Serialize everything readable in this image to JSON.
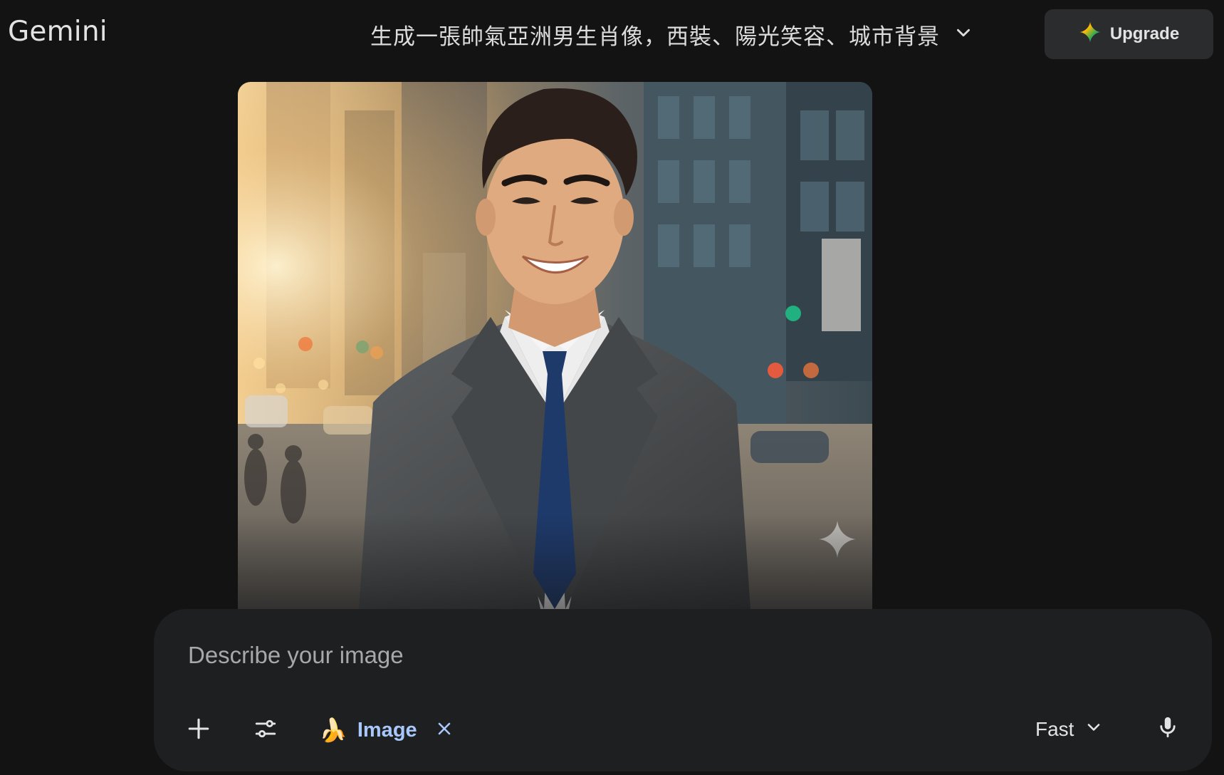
{
  "app": {
    "brand": "Gemini"
  },
  "header": {
    "conversation_title": "生成一張帥氣亞洲男生肖像，西裝、陽光笑容、城市背景",
    "upgrade_label": "Upgrade"
  },
  "composer": {
    "placeholder": "Describe your image",
    "value": "",
    "tool_chip": {
      "label": "Image",
      "emoji": "🍌"
    },
    "model_label": "Fast"
  },
  "colors": {
    "background": "#131314",
    "surface": "#1e1f20",
    "upgrade_bg": "#2b2c2e",
    "chip_accent": "#a8c7fa",
    "text": "#e3e3e3"
  },
  "icons": {
    "title_dropdown": "chevron-down-icon",
    "upgrade": "gemini-sparkle-icon",
    "add": "plus-icon",
    "tools": "tune-icon",
    "chip_remove": "close-icon",
    "model_dropdown": "chevron-down-icon",
    "voice": "microphone-icon",
    "watermark": "sparkle-icon"
  }
}
